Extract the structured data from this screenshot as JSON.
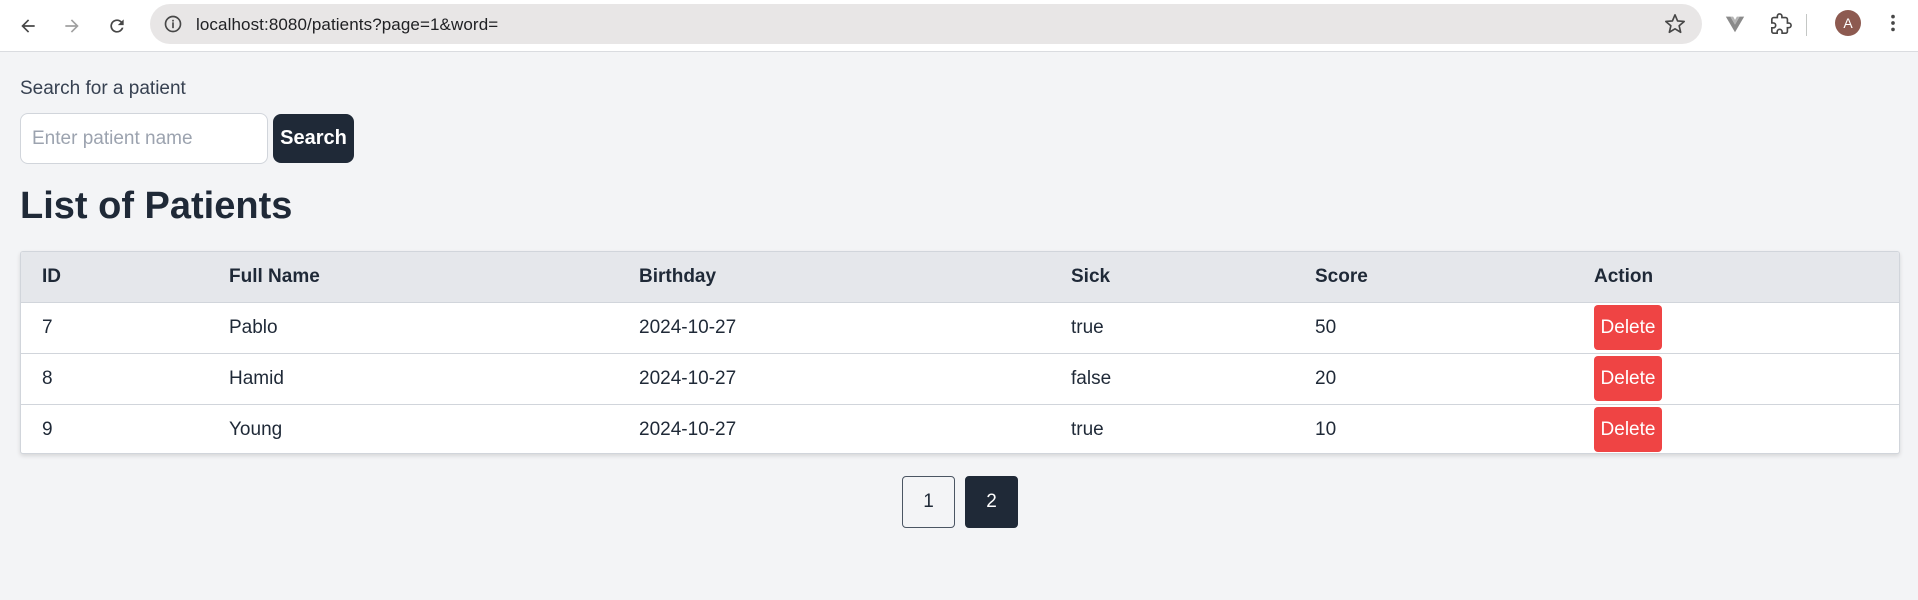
{
  "browser": {
    "url": "localhost:8080/patients?page=1&word=",
    "profile_initial": "A"
  },
  "search": {
    "label": "Search for a patient",
    "placeholder": "Enter patient name",
    "value": "",
    "button_label": "Search"
  },
  "page_title": "List of Patients",
  "table": {
    "headers": [
      "ID",
      "Full Name",
      "Birthday",
      "Sick",
      "Score",
      "Action"
    ],
    "rows": [
      {
        "id": "7",
        "full_name": "Pablo",
        "birthday": "2024-10-27",
        "sick": "true",
        "score": "50",
        "action_label": "Delete"
      },
      {
        "id": "8",
        "full_name": "Hamid",
        "birthday": "2024-10-27",
        "sick": "false",
        "score": "20",
        "action_label": "Delete"
      },
      {
        "id": "9",
        "full_name": "Young",
        "birthday": "2024-10-27",
        "sick": "true",
        "score": "10",
        "action_label": "Delete"
      }
    ]
  },
  "pagination": {
    "pages": [
      "1",
      "2"
    ],
    "current_page": "2"
  },
  "colors": {
    "primary": "#1f2937",
    "danger": "#ef4444",
    "background": "#f3f4f6"
  }
}
